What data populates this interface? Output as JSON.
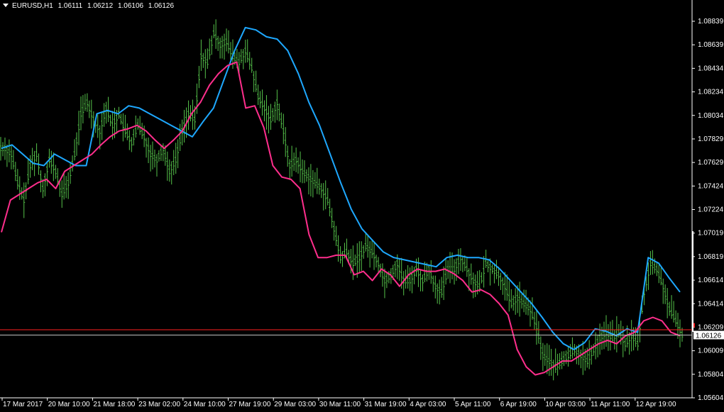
{
  "header": {
    "symbol": "EURUSD,H1",
    "open": "1.06111",
    "high": "1.06212",
    "low": "1.06106",
    "close": "1.06126",
    "dropdown_icon": "triangle-down-icon"
  },
  "colors": {
    "background": "#000000",
    "bars": "#55c24a",
    "ma_fast": "#ff2e8c",
    "ma_slow": "#1ea8ff",
    "price_line": "#ff2020",
    "axis": "#ffffff"
  },
  "price_label": "1.06126",
  "chart_data": {
    "type": "ohlc",
    "y_ticks": [
      "1.08839",
      "1.08639",
      "1.08434",
      "1.08234",
      "1.08034",
      "1.07829",
      "1.07629",
      "1.07424",
      "1.07224",
      "1.07019",
      "1.06819",
      "1.06614",
      "1.06414",
      "1.06209",
      "1.06009",
      "1.05804",
      "1.05604"
    ],
    "x_ticks": [
      "17 Mar 2017",
      "20 Mar 10:00",
      "21 Mar 18:00",
      "23 Mar 02:00",
      "24 Mar 10:00",
      "27 Mar 19:00",
      "29 Mar 03:00",
      "30 Mar 11:00",
      "31 Mar 19:00",
      "4 Apr 03:00",
      "5 Apr 11:00",
      "6 Apr 19:00",
      "10 Apr 03:00",
      "11 Apr 11:00",
      "12 Apr 19:00"
    ],
    "ylim": [
      1.0558,
      1.0904
    ],
    "current_price": 1.06126,
    "price_lines": [
      1.06172,
      1.06126
    ],
    "close_series": [
      1.0775,
      1.077,
      1.0745,
      1.073,
      1.076,
      1.077,
      1.074,
      1.0765,
      1.0755,
      1.0735,
      1.0745,
      1.077,
      1.0805,
      1.0815,
      1.08,
      1.079,
      1.081,
      1.0795,
      1.0805,
      1.079,
      1.078,
      1.0795,
      1.0785,
      1.077,
      1.0765,
      1.0775,
      1.0755,
      1.0765,
      1.079,
      1.0805,
      1.08,
      1.0855,
      1.085,
      1.0875,
      1.0865,
      1.0868,
      1.0855,
      1.085,
      1.086,
      1.0845,
      1.082,
      1.081,
      1.08,
      1.0815,
      1.079,
      1.076,
      1.0765,
      1.0755,
      1.075,
      1.0745,
      1.074,
      1.073,
      1.0705,
      1.068,
      1.0685,
      1.0675,
      1.068,
      1.069,
      1.0685,
      1.0675,
      1.066,
      1.0665,
      1.0675,
      1.066,
      1.066,
      1.067,
      1.066,
      1.067,
      1.0655,
      1.065,
      1.067,
      1.067,
      1.068,
      1.067,
      1.066,
      1.0655,
      1.0675,
      1.067,
      1.0665,
      1.0655,
      1.064,
      1.0645,
      1.064,
      1.0635,
      1.062,
      1.0595,
      1.059,
      1.0585,
      1.059,
      1.0595,
      1.06,
      1.0595,
      1.059,
      1.06,
      1.061,
      1.0615,
      1.061,
      1.0615,
      1.0605,
      1.0612,
      1.0605,
      1.065,
      1.0675,
      1.067,
      1.0655,
      1.0635,
      1.0625,
      1.0613
    ],
    "ma_fast": [
      1.0702,
      1.073,
      1.0735,
      1.074,
      1.0745,
      1.0748,
      1.074,
      1.0755,
      1.076,
      1.0765,
      1.077,
      1.0778,
      1.0785,
      1.079,
      1.0792,
      1.0795,
      1.079,
      1.0782,
      1.0775,
      1.0782,
      1.079,
      1.0805,
      1.0815,
      1.083,
      1.084,
      1.0847,
      1.085,
      1.081,
      1.0812,
      1.0793,
      1.076,
      1.075,
      1.0748,
      1.074,
      1.07,
      1.068,
      1.068,
      1.0682,
      1.0682,
      1.0665,
      1.0668,
      1.066,
      1.067,
      1.0665,
      1.0655,
      1.0665,
      1.067,
      1.0668,
      1.0668,
      1.067,
      1.0666,
      1.066,
      1.065,
      1.0652,
      1.0648,
      1.064,
      1.063,
      1.06,
      1.0585,
      1.0578,
      1.058,
      1.0585,
      1.059,
      1.059,
      1.0595,
      1.06,
      1.0605,
      1.0608,
      1.0605,
      1.0612,
      1.0615,
      1.0625,
      1.0628,
      1.0625,
      1.0615,
      1.0612
    ],
    "ma_slow": [
      1.0775,
      1.0778,
      1.077,
      1.0762,
      1.076,
      1.077,
      1.0765,
      1.076,
      1.076,
      1.0805,
      1.0808,
      1.0805,
      1.0812,
      1.081,
      1.0805,
      1.08,
      1.0795,
      1.079,
      1.0785,
      1.0798,
      1.081,
      1.0835,
      1.086,
      1.088,
      1.0878,
      1.0872,
      1.087,
      1.086,
      1.084,
      1.0815,
      1.0795,
      1.077,
      1.0745,
      1.0722,
      1.0705,
      1.0695,
      1.0685,
      1.068,
      1.0678,
      1.0676,
      1.0674,
      1.0672,
      1.068,
      1.0682,
      1.068,
      1.068,
      1.0678,
      1.067,
      1.066,
      1.065,
      1.064,
      1.0628,
      1.0615,
      1.0605,
      1.06,
      1.0606,
      1.0618,
      1.0616,
      1.0612,
      1.0618,
      1.0615,
      1.068,
      1.0675,
      1.0662,
      1.065
    ]
  }
}
